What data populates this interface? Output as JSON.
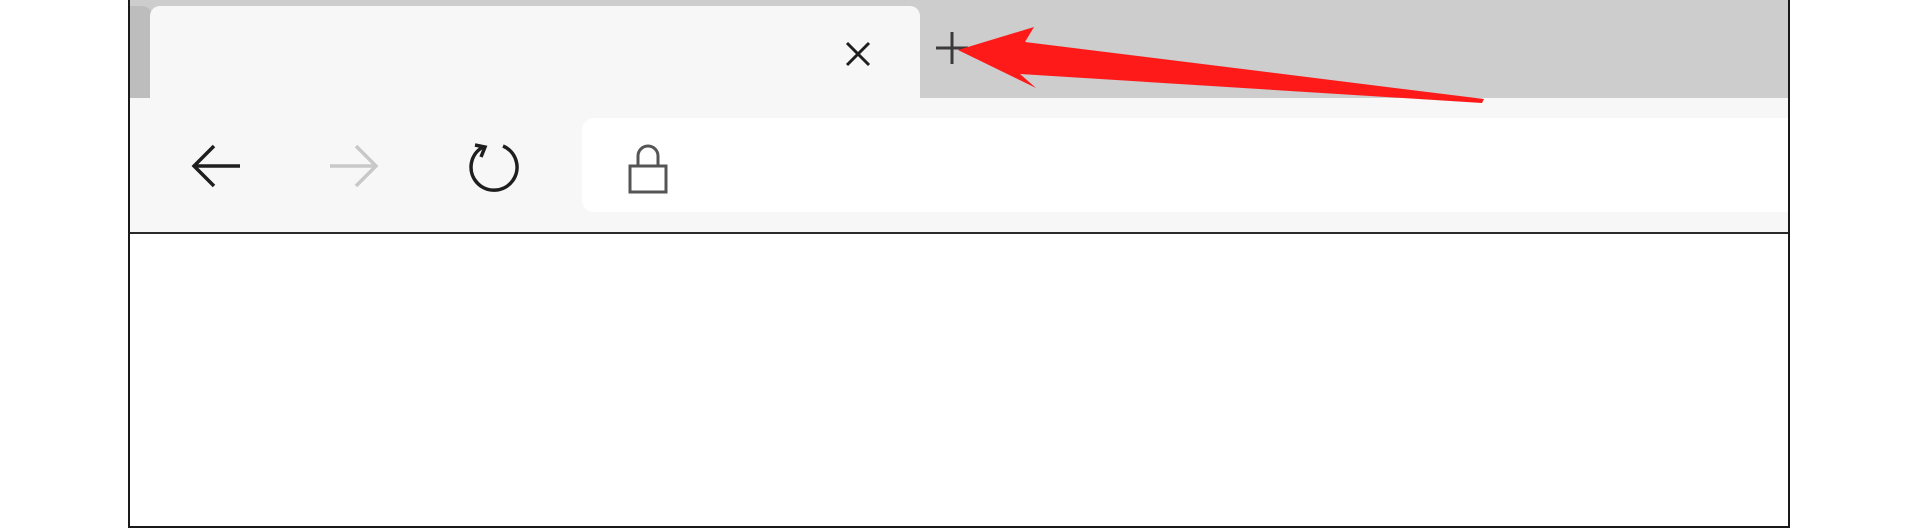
{
  "tab": {
    "title": "",
    "close_icon": "close-icon"
  },
  "new_tab": {
    "icon": "plus-icon"
  },
  "toolbar": {
    "back_icon": "arrow-left-icon",
    "forward_icon": "arrow-right-icon",
    "refresh_icon": "refresh-icon",
    "forward_enabled": false
  },
  "address_bar": {
    "lock_icon": "lock-icon",
    "url": ""
  },
  "annotation": {
    "icon": "red-arrow-icon",
    "color": "#ff1a1a",
    "points_to": "new-tab-button"
  },
  "colors": {
    "tabstrip": "#cdcdcd",
    "active_tab": "#f7f7f7",
    "toolbar": "#f7f7f7",
    "address_bar": "#ffffff",
    "disabled_icon": "#c8c8c8"
  }
}
